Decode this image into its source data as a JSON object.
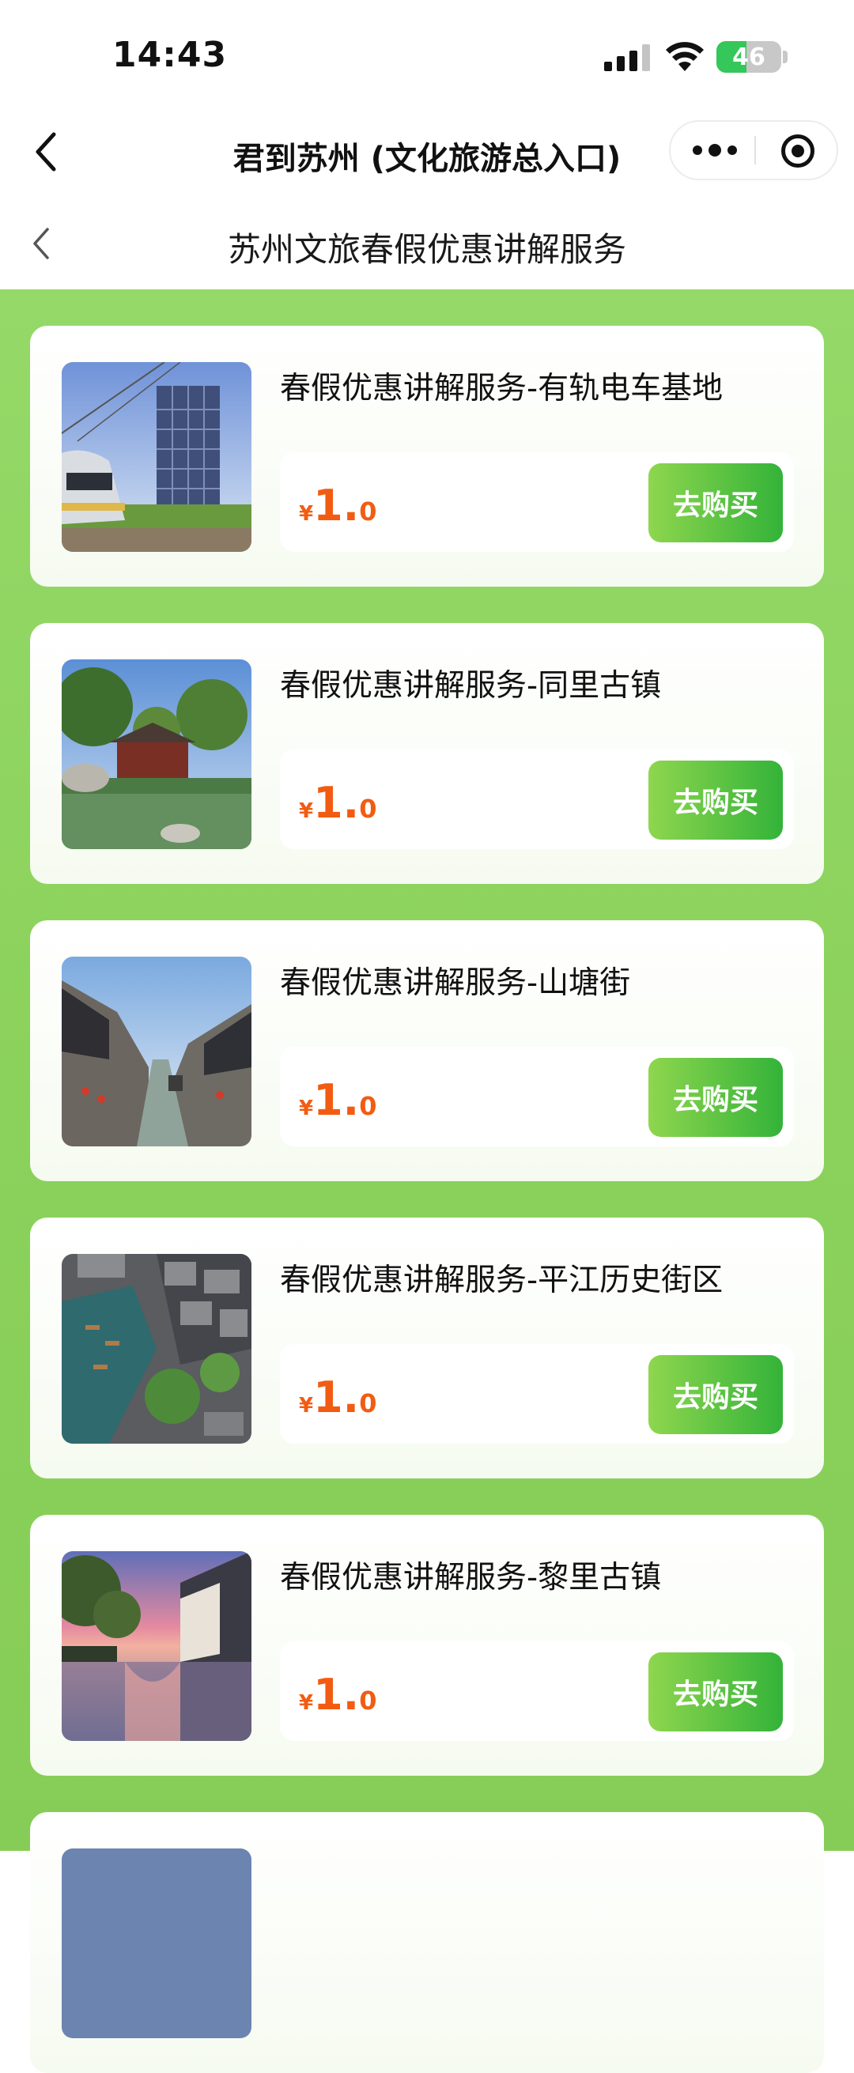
{
  "status_bar": {
    "time": "14:43",
    "battery": "46",
    "battery_level": 0.46
  },
  "nav": {
    "title": "君到苏州 (文化旅游总入口)"
  },
  "page": {
    "subtitle": "苏州文旅春假优惠讲解服务"
  },
  "products": [
    {
      "title": "春假优惠讲解服务-有轨电车基地",
      "currency": "¥",
      "price_int": "1.",
      "price_dec": "0",
      "buy_label": "去购买",
      "image": "tram-depot-photo"
    },
    {
      "title": "春假优惠讲解服务-同里古镇",
      "currency": "¥",
      "price_int": "1.",
      "price_dec": "0",
      "buy_label": "去购买",
      "image": "tongli-garden-photo"
    },
    {
      "title": "春假优惠讲解服务-山塘街",
      "currency": "¥",
      "price_int": "1.",
      "price_dec": "0",
      "buy_label": "去购买",
      "image": "shantang-canal-photo"
    },
    {
      "title": "春假优惠讲解服务-平江历史街区",
      "currency": "¥",
      "price_int": "1.",
      "price_dec": "0",
      "buy_label": "去购买",
      "image": "pingjiang-aerial-photo"
    },
    {
      "title": "春假优惠讲解服务-黎里古镇",
      "currency": "¥",
      "price_int": "1.",
      "price_dec": "0",
      "buy_label": "去购买",
      "image": "lili-sunset-photo"
    }
  ],
  "colors": {
    "accent_green": "#33b339",
    "price_orange": "#f25c12",
    "background_green": "#8bd25c"
  }
}
